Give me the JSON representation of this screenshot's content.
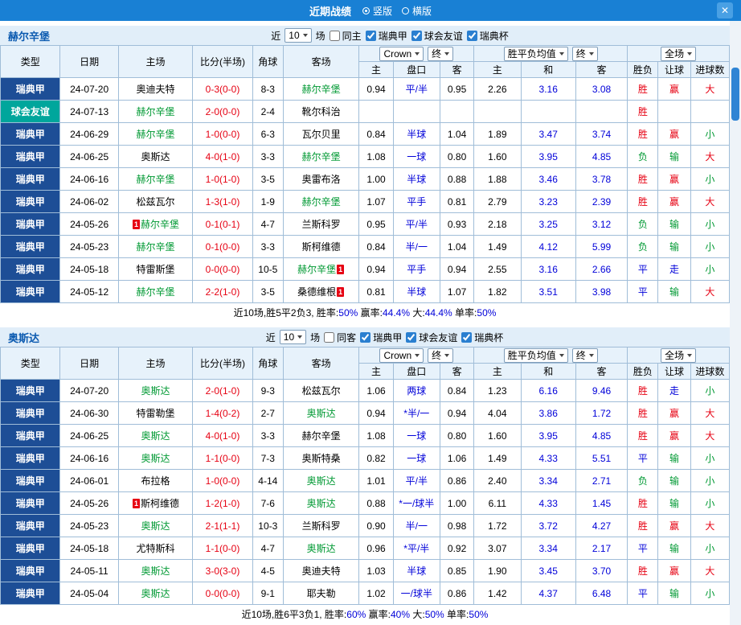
{
  "titlebar": {
    "title": "近期战绩",
    "layout_vertical": "竖版",
    "layout_horizontal": "横版",
    "vertical_selected": true,
    "close_icon": "✕"
  },
  "table_head": {
    "type": "类型",
    "date": "日期",
    "home": "主场",
    "score": "比分(半场)",
    "corner": "角球",
    "away": "客场",
    "odds_home": "主",
    "odds_handicap": "盘口",
    "odds_away": "客",
    "avg_home": "主",
    "avg_draw": "和",
    "avg_away": "客",
    "result": "胜负",
    "handicap_result": "让球",
    "goals": "进球数",
    "company_select": "Crown",
    "final_select_1": "终",
    "avg_select": "胜平负均值",
    "final_select_2": "终",
    "scope_select": "全场"
  },
  "sections": [
    {
      "team": "赫尔辛堡",
      "filter": {
        "near": "近",
        "count": "10",
        "games": "场",
        "same": "同主",
        "same_checked": false,
        "league1": "瑞典甲",
        "league1_checked": true,
        "league2": "球会友谊",
        "league2_checked": true,
        "league3": "瑞典杯",
        "league3_checked": true
      },
      "rows": [
        {
          "type": "瑞典甲",
          "type_cls": "t-league",
          "date": "24-07-20",
          "home_pre": "",
          "home": "奥迪夫特",
          "home_cls": "c-black",
          "home_post": "",
          "score": "0-3(0-0)",
          "corner": "8-3",
          "away_pre": "",
          "away": "赫尔辛堡",
          "away_cls": "c-green",
          "away_post": "",
          "o1": "0.94",
          "pan": "平/半",
          "o2": "0.95",
          "m1": "2.26",
          "m2": "3.16",
          "m3": "3.08",
          "res": "胜",
          "res_cls": "c-red",
          "lb": "赢",
          "lb_cls": "c-red",
          "big": "大",
          "big_cls": "c-red"
        },
        {
          "type": "球会友谊",
          "type_cls": "t-friendly",
          "date": "24-07-13",
          "home_pre": "",
          "home": "赫尔辛堡",
          "home_cls": "c-green",
          "home_post": "",
          "score": "2-0(0-0)",
          "corner": "2-4",
          "away_pre": "",
          "away": "靴尔科治",
          "away_cls": "c-black",
          "away_post": "",
          "o1": "",
          "pan": "",
          "o2": "",
          "m1": "",
          "m2": "",
          "m3": "",
          "res": "胜",
          "res_cls": "c-red",
          "lb": "",
          "lb_cls": "",
          "big": "",
          "big_cls": ""
        },
        {
          "type": "瑞典甲",
          "type_cls": "t-league",
          "date": "24-06-29",
          "home_pre": "",
          "home": "赫尔辛堡",
          "home_cls": "c-green",
          "home_post": "",
          "score": "1-0(0-0)",
          "corner": "6-3",
          "away_pre": "",
          "away": "瓦尔贝里",
          "away_cls": "c-black",
          "away_post": "",
          "o1": "0.84",
          "pan": "半球",
          "o2": "1.04",
          "m1": "1.89",
          "m2": "3.47",
          "m3": "3.74",
          "res": "胜",
          "res_cls": "c-red",
          "lb": "赢",
          "lb_cls": "c-red",
          "big": "小",
          "big_cls": "c-green"
        },
        {
          "type": "瑞典甲",
          "type_cls": "t-league",
          "date": "24-06-25",
          "home_pre": "",
          "home": "奥斯达",
          "home_cls": "c-black",
          "home_post": "",
          "score": "4-0(1-0)",
          "corner": "3-3",
          "away_pre": "",
          "away": "赫尔辛堡",
          "away_cls": "c-green",
          "away_post": "",
          "o1": "1.08",
          "pan": "一球",
          "o2": "0.80",
          "m1": "1.60",
          "m2": "3.95",
          "m3": "4.85",
          "res": "负",
          "res_cls": "c-green",
          "lb": "输",
          "lb_cls": "c-green",
          "big": "大",
          "big_cls": "c-red"
        },
        {
          "type": "瑞典甲",
          "type_cls": "t-league",
          "date": "24-06-16",
          "home_pre": "",
          "home": "赫尔辛堡",
          "home_cls": "c-green",
          "home_post": "",
          "score": "1-0(1-0)",
          "corner": "3-5",
          "away_pre": "",
          "away": "奥雷布洛",
          "away_cls": "c-black",
          "away_post": "",
          "o1": "1.00",
          "pan": "半球",
          "o2": "0.88",
          "m1": "1.88",
          "m2": "3.46",
          "m3": "3.78",
          "res": "胜",
          "res_cls": "c-red",
          "lb": "赢",
          "lb_cls": "c-red",
          "big": "小",
          "big_cls": "c-green"
        },
        {
          "type": "瑞典甲",
          "type_cls": "t-league",
          "date": "24-06-02",
          "home_pre": "",
          "home": "松兹瓦尔",
          "home_cls": "c-black",
          "home_post": "",
          "score": "1-3(1-0)",
          "corner": "1-9",
          "away_pre": "",
          "away": "赫尔辛堡",
          "away_cls": "c-green",
          "away_post": "",
          "o1": "1.07",
          "pan": "平手",
          "o2": "0.81",
          "m1": "2.79",
          "m2": "3.23",
          "m3": "2.39",
          "res": "胜",
          "res_cls": "c-red",
          "lb": "赢",
          "lb_cls": "c-red",
          "big": "大",
          "big_cls": "c-red"
        },
        {
          "type": "瑞典甲",
          "type_cls": "t-league",
          "date": "24-05-26",
          "home_pre": "1",
          "home": "赫尔辛堡",
          "home_cls": "c-green",
          "home_post": "",
          "score": "0-1(0-1)",
          "corner": "4-7",
          "away_pre": "",
          "away": "兰斯科罗",
          "away_cls": "c-black",
          "away_post": "",
          "o1": "0.95",
          "pan": "平/半",
          "o2": "0.93",
          "m1": "2.18",
          "m2": "3.25",
          "m3": "3.12",
          "res": "负",
          "res_cls": "c-green",
          "lb": "输",
          "lb_cls": "c-green",
          "big": "小",
          "big_cls": "c-green"
        },
        {
          "type": "瑞典甲",
          "type_cls": "t-league",
          "date": "24-05-23",
          "home_pre": "",
          "home": "赫尔辛堡",
          "home_cls": "c-green",
          "home_post": "",
          "score": "0-1(0-0)",
          "corner": "3-3",
          "away_pre": "",
          "away": "斯柯维德",
          "away_cls": "c-black",
          "away_post": "",
          "o1": "0.84",
          "pan": "半/一",
          "o2": "1.04",
          "m1": "1.49",
          "m2": "4.12",
          "m3": "5.99",
          "res": "负",
          "res_cls": "c-green",
          "lb": "输",
          "lb_cls": "c-green",
          "big": "小",
          "big_cls": "c-green"
        },
        {
          "type": "瑞典甲",
          "type_cls": "t-league",
          "date": "24-05-18",
          "home_pre": "",
          "home": "特雷斯堡",
          "home_cls": "c-black",
          "home_post": "",
          "score": "0-0(0-0)",
          "corner": "10-5",
          "away_pre": "",
          "away": "赫尔辛堡",
          "away_cls": "c-green",
          "away_post": "1",
          "o1": "0.94",
          "pan": "平手",
          "o2": "0.94",
          "m1": "2.55",
          "m2": "3.16",
          "m3": "2.66",
          "res": "平",
          "res_cls": "c-blue",
          "lb": "走",
          "lb_cls": "c-blue",
          "big": "小",
          "big_cls": "c-green"
        },
        {
          "type": "瑞典甲",
          "type_cls": "t-league",
          "date": "24-05-12",
          "home_pre": "",
          "home": "赫尔辛堡",
          "home_cls": "c-green",
          "home_post": "",
          "score": "2-2(1-0)",
          "corner": "3-5",
          "away_pre": "",
          "away": "桑德维根",
          "away_cls": "c-black",
          "away_post": "1",
          "o1": "0.81",
          "pan": "半球",
          "o2": "1.07",
          "m1": "1.82",
          "m2": "3.51",
          "m3": "3.98",
          "res": "平",
          "res_cls": "c-blue",
          "lb": "输",
          "lb_cls": "c-green",
          "big": "大",
          "big_cls": "c-red"
        }
      ],
      "summary": {
        "p1": "近10场,胜5平2负3, 胜率:",
        "v1": "50%",
        "p2": " 赢率:",
        "v2": "44.4%",
        "p3": " 大:",
        "v3": "44.4%",
        "p4": " 单率:",
        "v4": "50%"
      }
    },
    {
      "team": "奥斯达",
      "filter": {
        "near": "近",
        "count": "10",
        "games": "场",
        "same": "同客",
        "same_checked": false,
        "league1": "瑞典甲",
        "league1_checked": true,
        "league2": "球会友谊",
        "league2_checked": true,
        "league3": "瑞典杯",
        "league3_checked": true
      },
      "rows": [
        {
          "type": "瑞典甲",
          "type_cls": "t-league",
          "date": "24-07-20",
          "home_pre": "",
          "home": "奥斯达",
          "home_cls": "c-green",
          "home_post": "",
          "score": "2-0(1-0)",
          "corner": "9-3",
          "away_pre": "",
          "away": "松兹瓦尔",
          "away_cls": "c-black",
          "away_post": "",
          "o1": "1.06",
          "pan": "两球",
          "o2": "0.84",
          "m1": "1.23",
          "m2": "6.16",
          "m3": "9.46",
          "res": "胜",
          "res_cls": "c-red",
          "lb": "走",
          "lb_cls": "c-blue",
          "big": "小",
          "big_cls": "c-green"
        },
        {
          "type": "瑞典甲",
          "type_cls": "t-league",
          "date": "24-06-30",
          "home_pre": "",
          "home": "特雷勒堡",
          "home_cls": "c-black",
          "home_post": "",
          "score": "1-4(0-2)",
          "corner": "2-7",
          "away_pre": "",
          "away": "奥斯达",
          "away_cls": "c-green",
          "away_post": "",
          "o1": "0.94",
          "pan": "*半/一",
          "o2": "0.94",
          "m1": "4.04",
          "m2": "3.86",
          "m3": "1.72",
          "res": "胜",
          "res_cls": "c-red",
          "lb": "赢",
          "lb_cls": "c-red",
          "big": "大",
          "big_cls": "c-red"
        },
        {
          "type": "瑞典甲",
          "type_cls": "t-league",
          "date": "24-06-25",
          "home_pre": "",
          "home": "奥斯达",
          "home_cls": "c-green",
          "home_post": "",
          "score": "4-0(1-0)",
          "corner": "3-3",
          "away_pre": "",
          "away": "赫尔辛堡",
          "away_cls": "c-black",
          "away_post": "",
          "o1": "1.08",
          "pan": "一球",
          "o2": "0.80",
          "m1": "1.60",
          "m2": "3.95",
          "m3": "4.85",
          "res": "胜",
          "res_cls": "c-red",
          "lb": "赢",
          "lb_cls": "c-red",
          "big": "大",
          "big_cls": "c-red"
        },
        {
          "type": "瑞典甲",
          "type_cls": "t-league",
          "date": "24-06-16",
          "home_pre": "",
          "home": "奥斯达",
          "home_cls": "c-green",
          "home_post": "",
          "score": "1-1(0-0)",
          "corner": "7-3",
          "away_pre": "",
          "away": "奥斯特桑",
          "away_cls": "c-black",
          "away_post": "",
          "o1": "0.82",
          "pan": "一球",
          "o2": "1.06",
          "m1": "1.49",
          "m2": "4.33",
          "m3": "5.51",
          "res": "平",
          "res_cls": "c-blue",
          "lb": "输",
          "lb_cls": "c-green",
          "big": "小",
          "big_cls": "c-green"
        },
        {
          "type": "瑞典甲",
          "type_cls": "t-league",
          "date": "24-06-01",
          "home_pre": "",
          "home": "布拉格",
          "home_cls": "c-black",
          "home_post": "",
          "score": "1-0(0-0)",
          "corner": "4-14",
          "away_pre": "",
          "away": "奥斯达",
          "away_cls": "c-green",
          "away_post": "",
          "o1": "1.01",
          "pan": "平/半",
          "o2": "0.86",
          "m1": "2.40",
          "m2": "3.34",
          "m3": "2.71",
          "res": "负",
          "res_cls": "c-green",
          "lb": "输",
          "lb_cls": "c-green",
          "big": "小",
          "big_cls": "c-green"
        },
        {
          "type": "瑞典甲",
          "type_cls": "t-league",
          "date": "24-05-26",
          "home_pre": "1",
          "home": "斯柯维德",
          "home_cls": "c-black",
          "home_post": "",
          "score": "1-2(1-0)",
          "corner": "7-6",
          "away_pre": "",
          "away": "奥斯达",
          "away_cls": "c-green",
          "away_post": "",
          "o1": "0.88",
          "pan": "*一/球半",
          "o2": "1.00",
          "m1": "6.11",
          "m2": "4.33",
          "m3": "1.45",
          "res": "胜",
          "res_cls": "c-red",
          "lb": "输",
          "lb_cls": "c-green",
          "big": "小",
          "big_cls": "c-green"
        },
        {
          "type": "瑞典甲",
          "type_cls": "t-league",
          "date": "24-05-23",
          "home_pre": "",
          "home": "奥斯达",
          "home_cls": "c-green",
          "home_post": "",
          "score": "2-1(1-1)",
          "corner": "10-3",
          "away_pre": "",
          "away": "兰斯科罗",
          "away_cls": "c-black",
          "away_post": "",
          "o1": "0.90",
          "pan": "半/一",
          "o2": "0.98",
          "m1": "1.72",
          "m2": "3.72",
          "m3": "4.27",
          "res": "胜",
          "res_cls": "c-red",
          "lb": "赢",
          "lb_cls": "c-red",
          "big": "大",
          "big_cls": "c-red"
        },
        {
          "type": "瑞典甲",
          "type_cls": "t-league",
          "date": "24-05-18",
          "home_pre": "",
          "home": "尤特斯科",
          "home_cls": "c-black",
          "home_post": "",
          "score": "1-1(0-0)",
          "corner": "4-7",
          "away_pre": "",
          "away": "奥斯达",
          "away_cls": "c-green",
          "away_post": "",
          "o1": "0.96",
          "pan": "*平/半",
          "o2": "0.92",
          "m1": "3.07",
          "m2": "3.34",
          "m3": "2.17",
          "res": "平",
          "res_cls": "c-blue",
          "lb": "输",
          "lb_cls": "c-green",
          "big": "小",
          "big_cls": "c-green"
        },
        {
          "type": "瑞典甲",
          "type_cls": "t-league",
          "date": "24-05-11",
          "home_pre": "",
          "home": "奥斯达",
          "home_cls": "c-green",
          "home_post": "",
          "score": "3-0(3-0)",
          "corner": "4-5",
          "away_pre": "",
          "away": "奥迪夫特",
          "away_cls": "c-black",
          "away_post": "",
          "o1": "1.03",
          "pan": "半球",
          "o2": "0.85",
          "m1": "1.90",
          "m2": "3.45",
          "m3": "3.70",
          "res": "胜",
          "res_cls": "c-red",
          "lb": "赢",
          "lb_cls": "c-red",
          "big": "大",
          "big_cls": "c-red"
        },
        {
          "type": "瑞典甲",
          "type_cls": "t-league",
          "date": "24-05-04",
          "home_pre": "",
          "home": "奥斯达",
          "home_cls": "c-green",
          "home_post": "",
          "score": "0-0(0-0)",
          "corner": "9-1",
          "away_pre": "",
          "away": "耶夫勒",
          "away_cls": "c-black",
          "away_post": "",
          "o1": "1.02",
          "pan": "一/球半",
          "o2": "0.86",
          "m1": "1.42",
          "m2": "4.37",
          "m3": "6.48",
          "res": "平",
          "res_cls": "c-blue",
          "lb": "输",
          "lb_cls": "c-green",
          "big": "小",
          "big_cls": "c-green"
        }
      ],
      "summary": {
        "p1": "近10场,胜6平3负1, 胜率:",
        "v1": "60%",
        "p2": " 赢率:",
        "v2": "40%",
        "p3": " 大:",
        "v3": "50%",
        "p4": " 单率:",
        "v4": "50%"
      }
    }
  ]
}
